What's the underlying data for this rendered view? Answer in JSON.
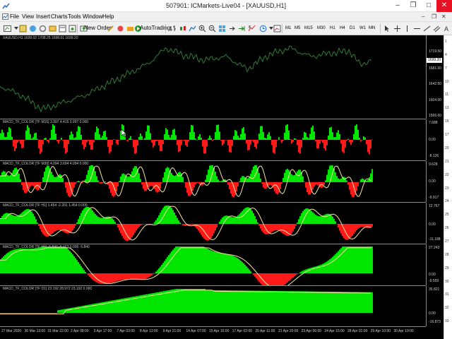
{
  "window": {
    "title": "507901: ICMarkets-Live04 - [XAUUSD,H1]"
  },
  "menu": {
    "items": [
      "File",
      "View",
      "Insert",
      "Charts",
      "Tools",
      "Window",
      "Help"
    ]
  },
  "toolbar": {
    "new_order": "New Order",
    "auto_trading": "AutoTrading",
    "timeframes": [
      "M1",
      "M5",
      "M15",
      "M30",
      "H1",
      "H4",
      "D1",
      "W1",
      "MN"
    ]
  },
  "colors": {
    "background": "#000000",
    "price_line": "#2e7d32",
    "hist_up": "#00e600",
    "hist_down": "#ff1a1a",
    "signal": "#f5e6a0"
  },
  "chart": {
    "symbol_label": "XAUUSD,H1  1699.02 1708.25 1698.01 1699.20",
    "price_ticks": [
      "1719.50",
      "1699.20",
      "1681.00",
      "1642.50",
      "1604.00",
      "1566.60"
    ],
    "current_price": "1699.20",
    "time_labels": [
      "27 Mar 2020",
      "30 Mar 13:00",
      "31 Mar 22:00",
      "2 Apr 08:00",
      "3 Apr 17:00",
      "7 Apr 03:00",
      "8 Apr 12:00",
      "9 Apr 21:00",
      "14 Apr 07:00",
      "15 Apr 16:00",
      "17 Apr 02:00",
      "20 Apr 11:00",
      "21 Apr 20:00",
      "23 Apr 06:00",
      "24 Apr 15:00",
      "28 Apr 01:00",
      "29 Apr 10:00",
      "30 Apr 19:00"
    ]
  },
  "indicators": [
    {
      "label": "MACD_TF_COLOR [TF M15]  3.997 4.415 3.997 0.000",
      "ticks": [
        "7.688",
        "0.00",
        "-8.126"
      ]
    },
    {
      "label": "MACD_TF_COLOR [TF M30]  4.094 3.694 4.094 0.000",
      "ticks": [
        "9.628",
        "0.00",
        "-9.917"
      ]
    },
    {
      "label": "MACD_TF_COLOR [TF H1]  1.454 -2.201 1.454 0.000",
      "ticks": [
        "12.767",
        "0.00",
        "-11.188"
      ]
    },
    {
      "label": "MACD_TF_COLOR [TF H4]  -5.840 -5.163 0.000 -5.840",
      "ticks": [
        "27.243",
        "0.00",
        "-9.559"
      ]
    },
    {
      "label": "MACD_TF_COLOR [TF D1]  23.192 28.972 23.192 0.000",
      "ticks": [
        "35.821",
        "0.00",
        "-16.873"
      ]
    }
  ],
  "right_strip": {
    "numbers": [
      "1",
      "4",
      "7",
      "10",
      "11",
      "13",
      "16",
      "17",
      "20",
      "21",
      "22",
      "23",
      "24",
      "25",
      "26",
      "27",
      "28",
      "29",
      "30",
      "31",
      "32",
      "33"
    ]
  }
}
